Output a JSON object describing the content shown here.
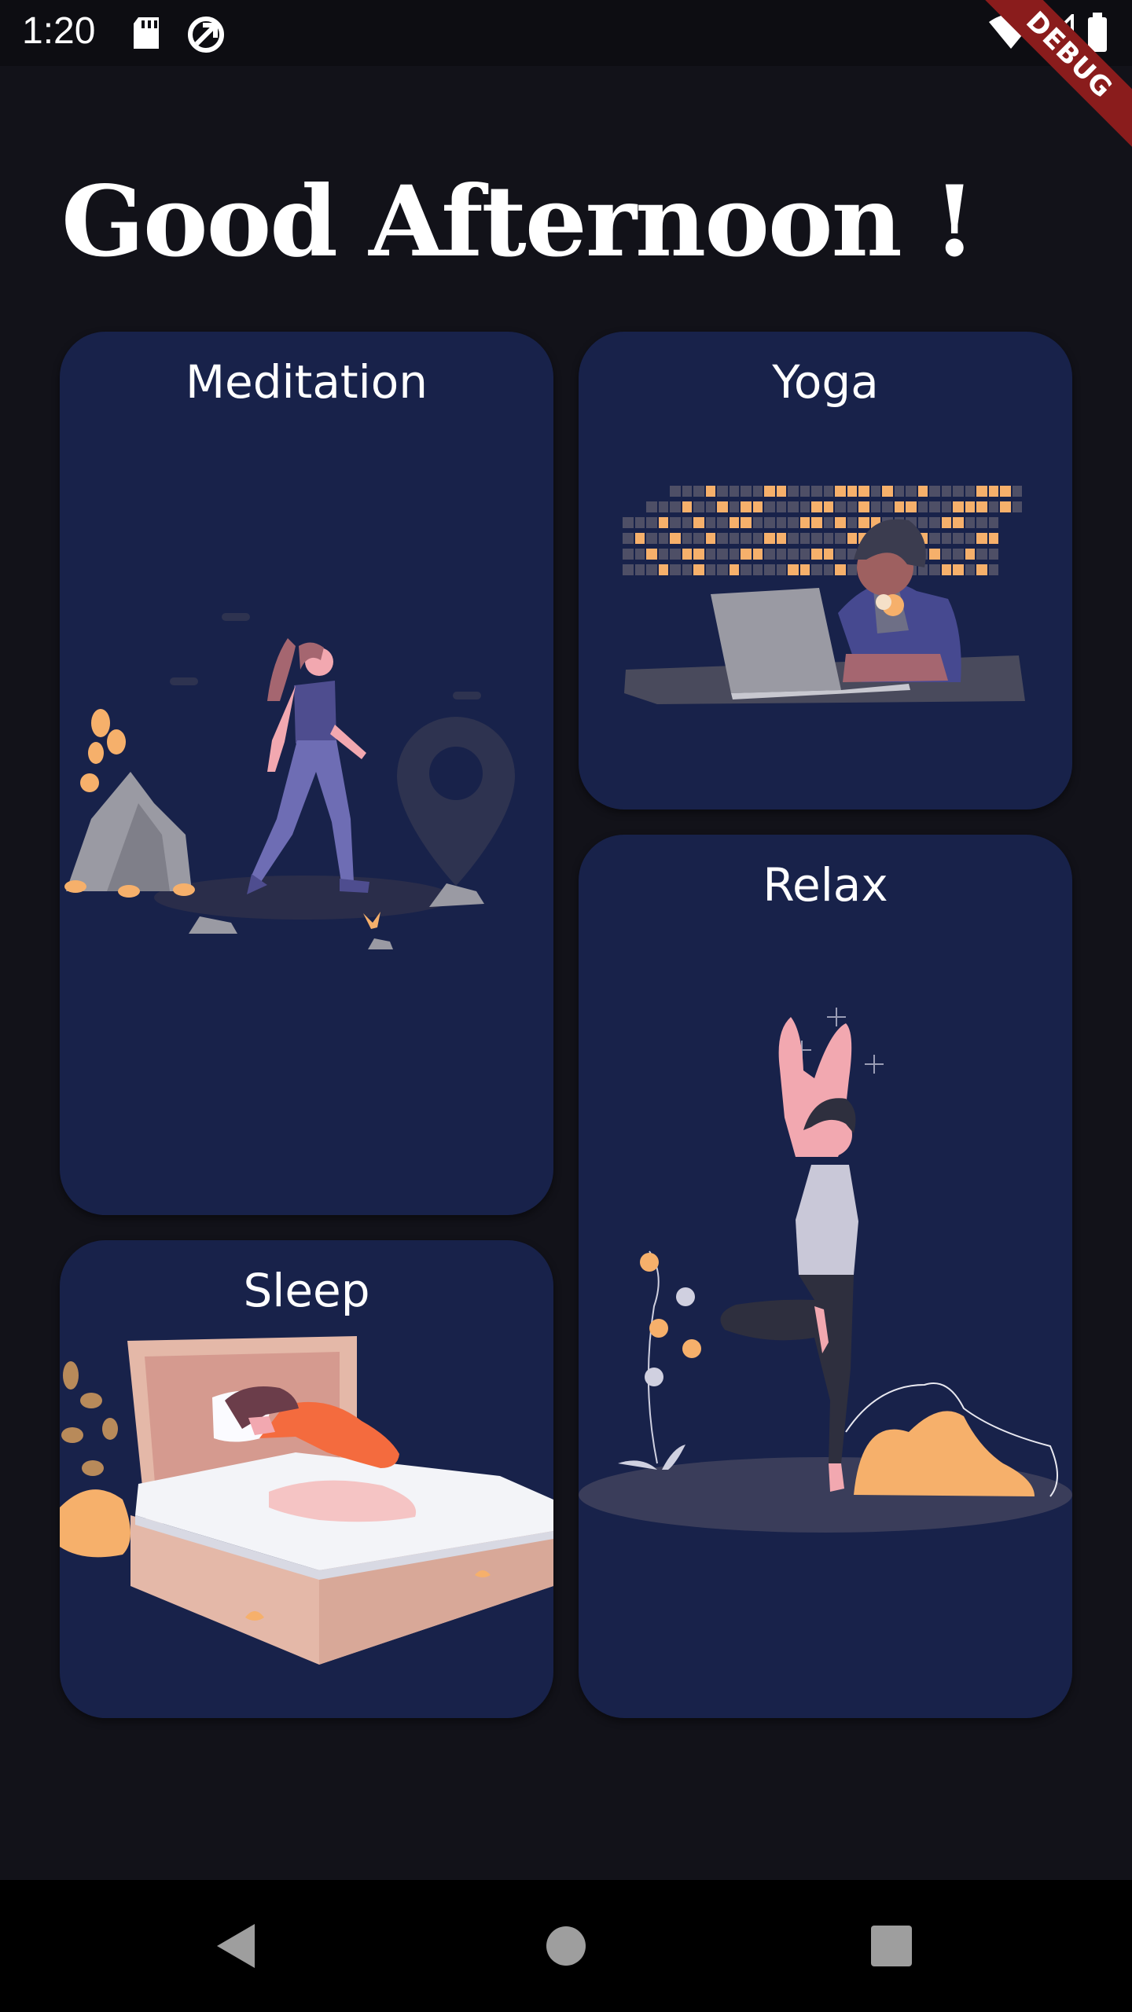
{
  "status_bar": {
    "time": "1:20",
    "icons": [
      "sd-card-icon",
      "sync-icon",
      "wifi-icon",
      "signal-icon",
      "battery-icon"
    ],
    "debug_label": "DEBUG"
  },
  "greeting": "Good Afternoon !",
  "cards": {
    "meditation": "Meditation",
    "yoga": "Yoga",
    "sleep": "Sleep",
    "relax": "Relax"
  },
  "colors": {
    "background": "#121219",
    "card": "#18224a",
    "accent_orange": "#f6b06b"
  },
  "nav": {
    "icons": [
      "back-icon",
      "home-icon",
      "recents-icon"
    ]
  }
}
